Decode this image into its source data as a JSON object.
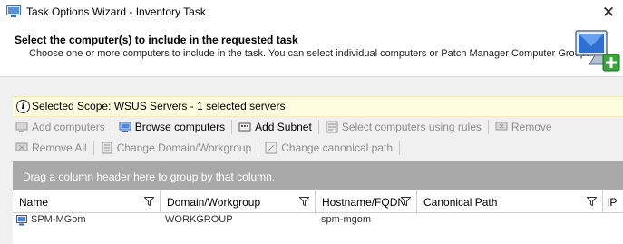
{
  "window": {
    "title": "Task Options Wizard - Inventory Task",
    "close_glyph": "✕"
  },
  "header": {
    "title": "Select the computer(s) to include in the requested task",
    "description": "Choose one or more computers to include in the task. You can select individual computers or Patch Manager Computer Groups",
    "icon": "computer-add-icon"
  },
  "scope": {
    "icon": "info-icon",
    "text": "Selected Scope: WSUS Servers - 1 selected servers"
  },
  "toolbar": {
    "row1": [
      {
        "label": "Add computers",
        "enabled": false,
        "icon": "add-computers-icon"
      },
      {
        "label": "Browse computers",
        "enabled": true,
        "icon": "browse-computers-icon"
      },
      {
        "label": "Add Subnet",
        "enabled": true,
        "icon": "add-subnet-icon"
      },
      {
        "label": "Select computers using rules",
        "enabled": false,
        "icon": "rules-icon"
      },
      {
        "label": "Remove",
        "enabled": false,
        "icon": "remove-icon"
      }
    ],
    "row2": [
      {
        "label": "Remove All",
        "enabled": false,
        "icon": "remove-all-icon"
      },
      {
        "label": "Change Domain/Workgroup",
        "enabled": false,
        "icon": "domain-icon"
      },
      {
        "label": "Change canonical path",
        "enabled": false,
        "icon": "canonical-path-icon"
      }
    ]
  },
  "group_panel": {
    "text": "Drag a column header here to group by that column."
  },
  "grid": {
    "columns": [
      "Name",
      "Domain/Workgroup",
      "Hostname/FQDN",
      "Canonical Path",
      "IP"
    ],
    "rows": [
      {
        "name": "SPM-MGom",
        "domain": "WORKGROUP",
        "hostname": "spm-mgom",
        "canonical": "",
        "ip": ""
      }
    ]
  },
  "colors": {
    "group_panel_bg": "#a9a9a9",
    "scope_bar_bg": "#fffbde",
    "disabled_text": "#8d8d8d"
  }
}
